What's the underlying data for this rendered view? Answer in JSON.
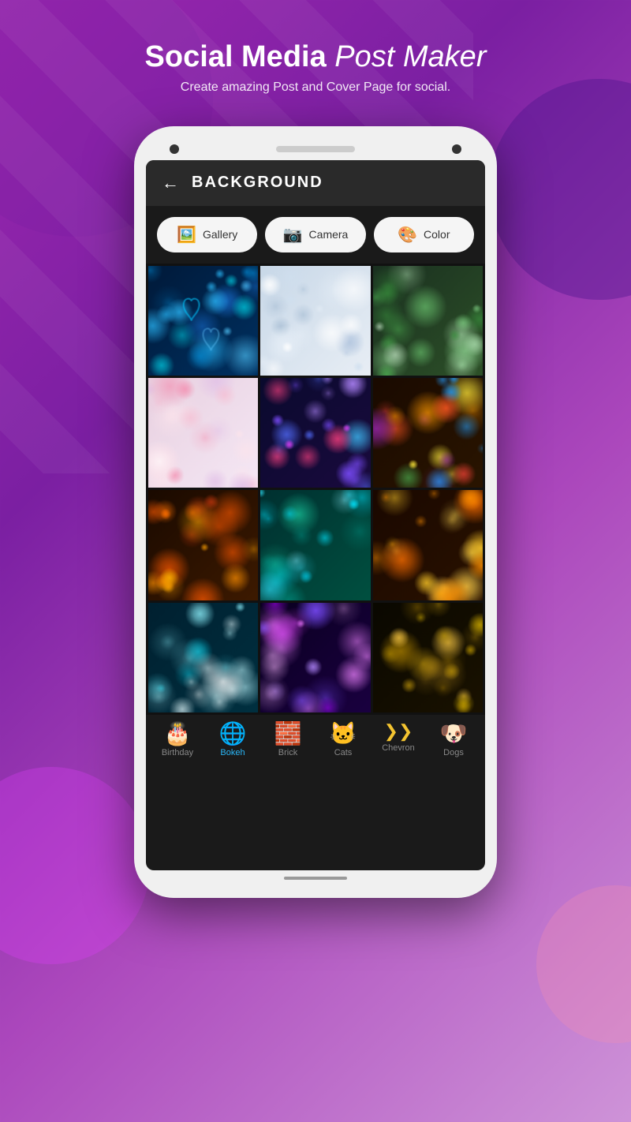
{
  "background": {
    "circles": [
      "bg-circle-1",
      "bg-circle-2",
      "bg-circle-3",
      "bg-circle-4"
    ]
  },
  "header": {
    "title_bold": "Social Media",
    "title_italic": "Post Maker",
    "subtitle": "Create amazing Post and Cover Page for social."
  },
  "phone": {
    "screen": {
      "topbar": {
        "back_label": "←",
        "title": "BACKGROUND"
      },
      "action_buttons": [
        {
          "id": "gallery",
          "icon": "🖼️",
          "label": "Gallery"
        },
        {
          "id": "camera",
          "icon": "📷",
          "label": "Camera"
        },
        {
          "id": "color",
          "icon": "🎨",
          "label": "Color"
        }
      ],
      "grid_images": [
        {
          "id": "img1",
          "type": "bokeh-blue-hearts"
        },
        {
          "id": "img2",
          "type": "bokeh-white-silver"
        },
        {
          "id": "img3",
          "type": "bokeh-green"
        },
        {
          "id": "img4",
          "type": "bokeh-pink-white"
        },
        {
          "id": "img5",
          "type": "bokeh-blue-purple"
        },
        {
          "id": "img6",
          "type": "bokeh-colorful-dark"
        },
        {
          "id": "img7",
          "type": "bokeh-orange-dark"
        },
        {
          "id": "img8",
          "type": "bokeh-teal-green"
        },
        {
          "id": "img9",
          "type": "bokeh-gold-orange"
        },
        {
          "id": "img10",
          "type": "bokeh-teal-white"
        },
        {
          "id": "img11",
          "type": "bokeh-purple-violet"
        },
        {
          "id": "img12",
          "type": "bokeh-dark-gold"
        }
      ],
      "tabs": [
        {
          "id": "birthday",
          "icon": "🎂",
          "label": "Birthday",
          "active": false
        },
        {
          "id": "bokeh",
          "icon": "🌐",
          "label": "Bokeh",
          "active": true
        },
        {
          "id": "brick",
          "icon": "🧱",
          "label": "Brick",
          "active": false
        },
        {
          "id": "cats",
          "icon": "🐱",
          "label": "Cats",
          "active": false
        },
        {
          "id": "chevron",
          "icon": "❯❯",
          "label": "Chevron",
          "active": false
        },
        {
          "id": "dogs",
          "icon": "🐶",
          "label": "Dogs",
          "active": false
        }
      ]
    }
  }
}
